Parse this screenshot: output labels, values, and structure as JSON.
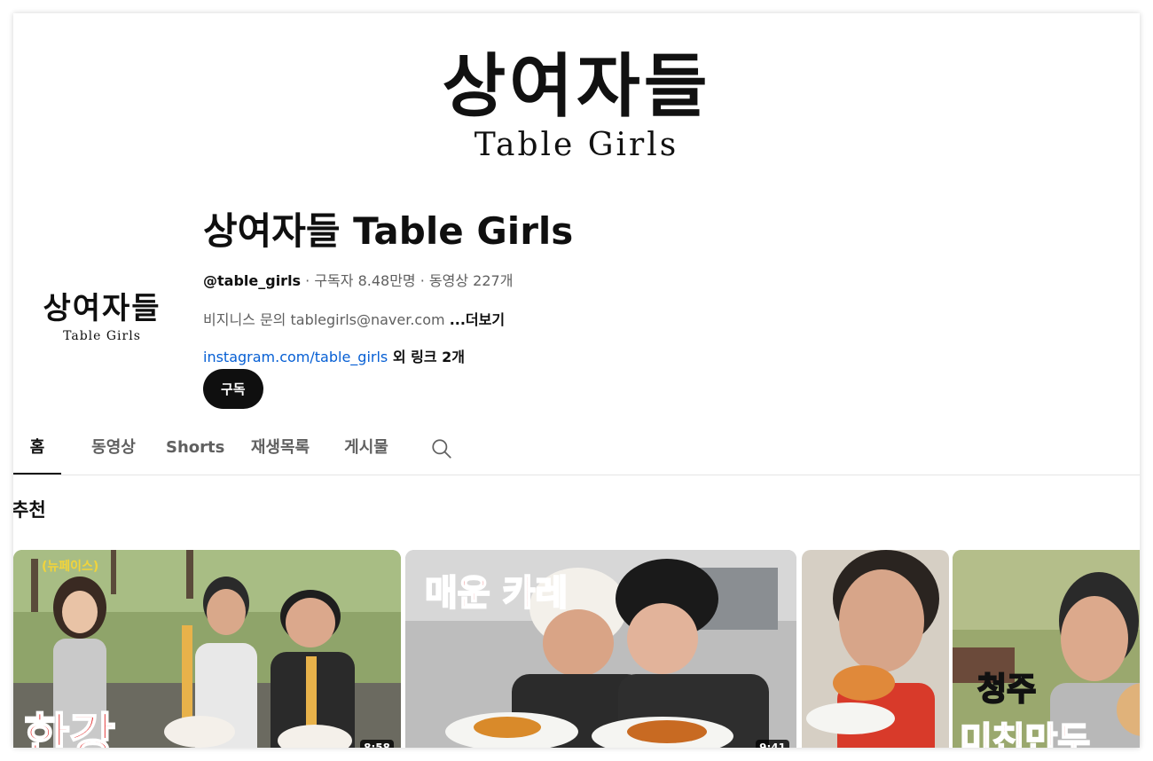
{
  "banner": {
    "title_kr": "상여자들",
    "title_en": "Table Girls"
  },
  "avatar": {
    "title_kr": "상여자들",
    "title_en": "Table Girls"
  },
  "channel": {
    "name": "상여자들 Table Girls",
    "handle": "@table_girls",
    "stats": " · 구독자 8.48만명 · 동영상 227개",
    "description": "비지니스 문의 tablegirls@naver.com ",
    "more_label": "...더보기",
    "link_text": "instagram.com/table_girls",
    "extra_links": " 외 링크 2개",
    "subscribe_label": "구독"
  },
  "tabs": [
    {
      "label": "홈",
      "active": true
    },
    {
      "label": "동영상"
    },
    {
      "label": "Shorts"
    },
    {
      "label": "재생목록"
    },
    {
      "label": "게시물"
    }
  ],
  "search_icon": "search-icon",
  "section": {
    "title": "추천"
  },
  "videos": [
    {
      "overlay_top": "(뉴페이스)",
      "overlay_bottom": "한강",
      "duration": "8:58"
    },
    {
      "overlay_top": "매운 카레",
      "duration": "9:41"
    },
    {
      "overlay_top": ""
    },
    {
      "overlay_top": "청주",
      "overlay_bottom": "미친만두"
    }
  ],
  "colors": {
    "link": "#065fd4",
    "subscribe_bg": "#0f0f0f",
    "overlay_red": "#e01b1b"
  }
}
